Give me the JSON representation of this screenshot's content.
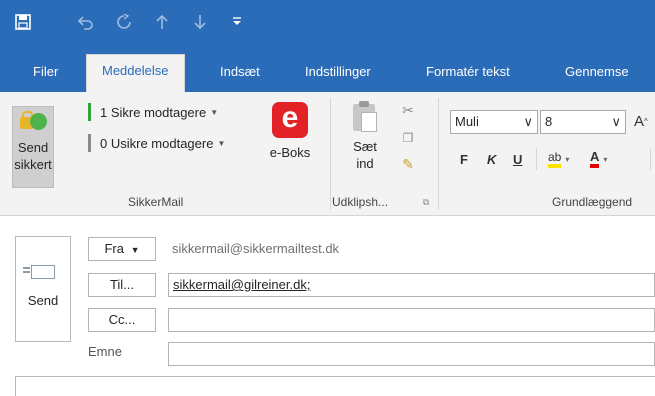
{
  "colors": {
    "accent": "#2b6cb8",
    "ribbon_bg": "#f3f3f3",
    "eboks_red": "#e32227",
    "secure_green": "#2ea43a",
    "unsecure_gray": "#8a8a8a"
  },
  "quick_access": {
    "icons": [
      "save-icon",
      "undo-icon",
      "redo-icon",
      "arrow-up-icon",
      "arrow-down-icon",
      "customize-dropdown-icon"
    ]
  },
  "tabs": [
    {
      "label": "Filer",
      "active": false
    },
    {
      "label": "Meddelelse",
      "active": true
    },
    {
      "label": "Indsæt",
      "active": false
    },
    {
      "label": "Indstillinger",
      "active": false
    },
    {
      "label": "Formatér tekst",
      "active": false
    },
    {
      "label": "Gennemse",
      "active": false
    }
  ],
  "ribbon": {
    "sikkermail": {
      "send_secure_line1": "Send",
      "send_secure_line2": "sikkert",
      "secure_recipients": "1 Sikre modtagere",
      "unsecure_recipients": "0 Usikre modtagere",
      "eboks_logo": "e",
      "eboks_label": "e-Boks",
      "group_label": "SikkerMail"
    },
    "clipboard": {
      "paste_line1": "Sæt",
      "paste_line2": "ind",
      "group_label": "Udklipsh..."
    },
    "basic_text": {
      "font_name": "Muli",
      "font_size": "8",
      "bold": "F",
      "italic": "K",
      "underline": "U",
      "group_label": "Grundlæggend"
    }
  },
  "compose": {
    "send_label": "Send",
    "from_button": "Fra",
    "from_value": "sikkermail@sikkermailtest.dk",
    "to_button": "Til...",
    "to_value": "sikkermail@gilreiner.dk;",
    "cc_button": "Cc...",
    "cc_value": "",
    "subject_label": "Emne",
    "subject_value": ""
  }
}
